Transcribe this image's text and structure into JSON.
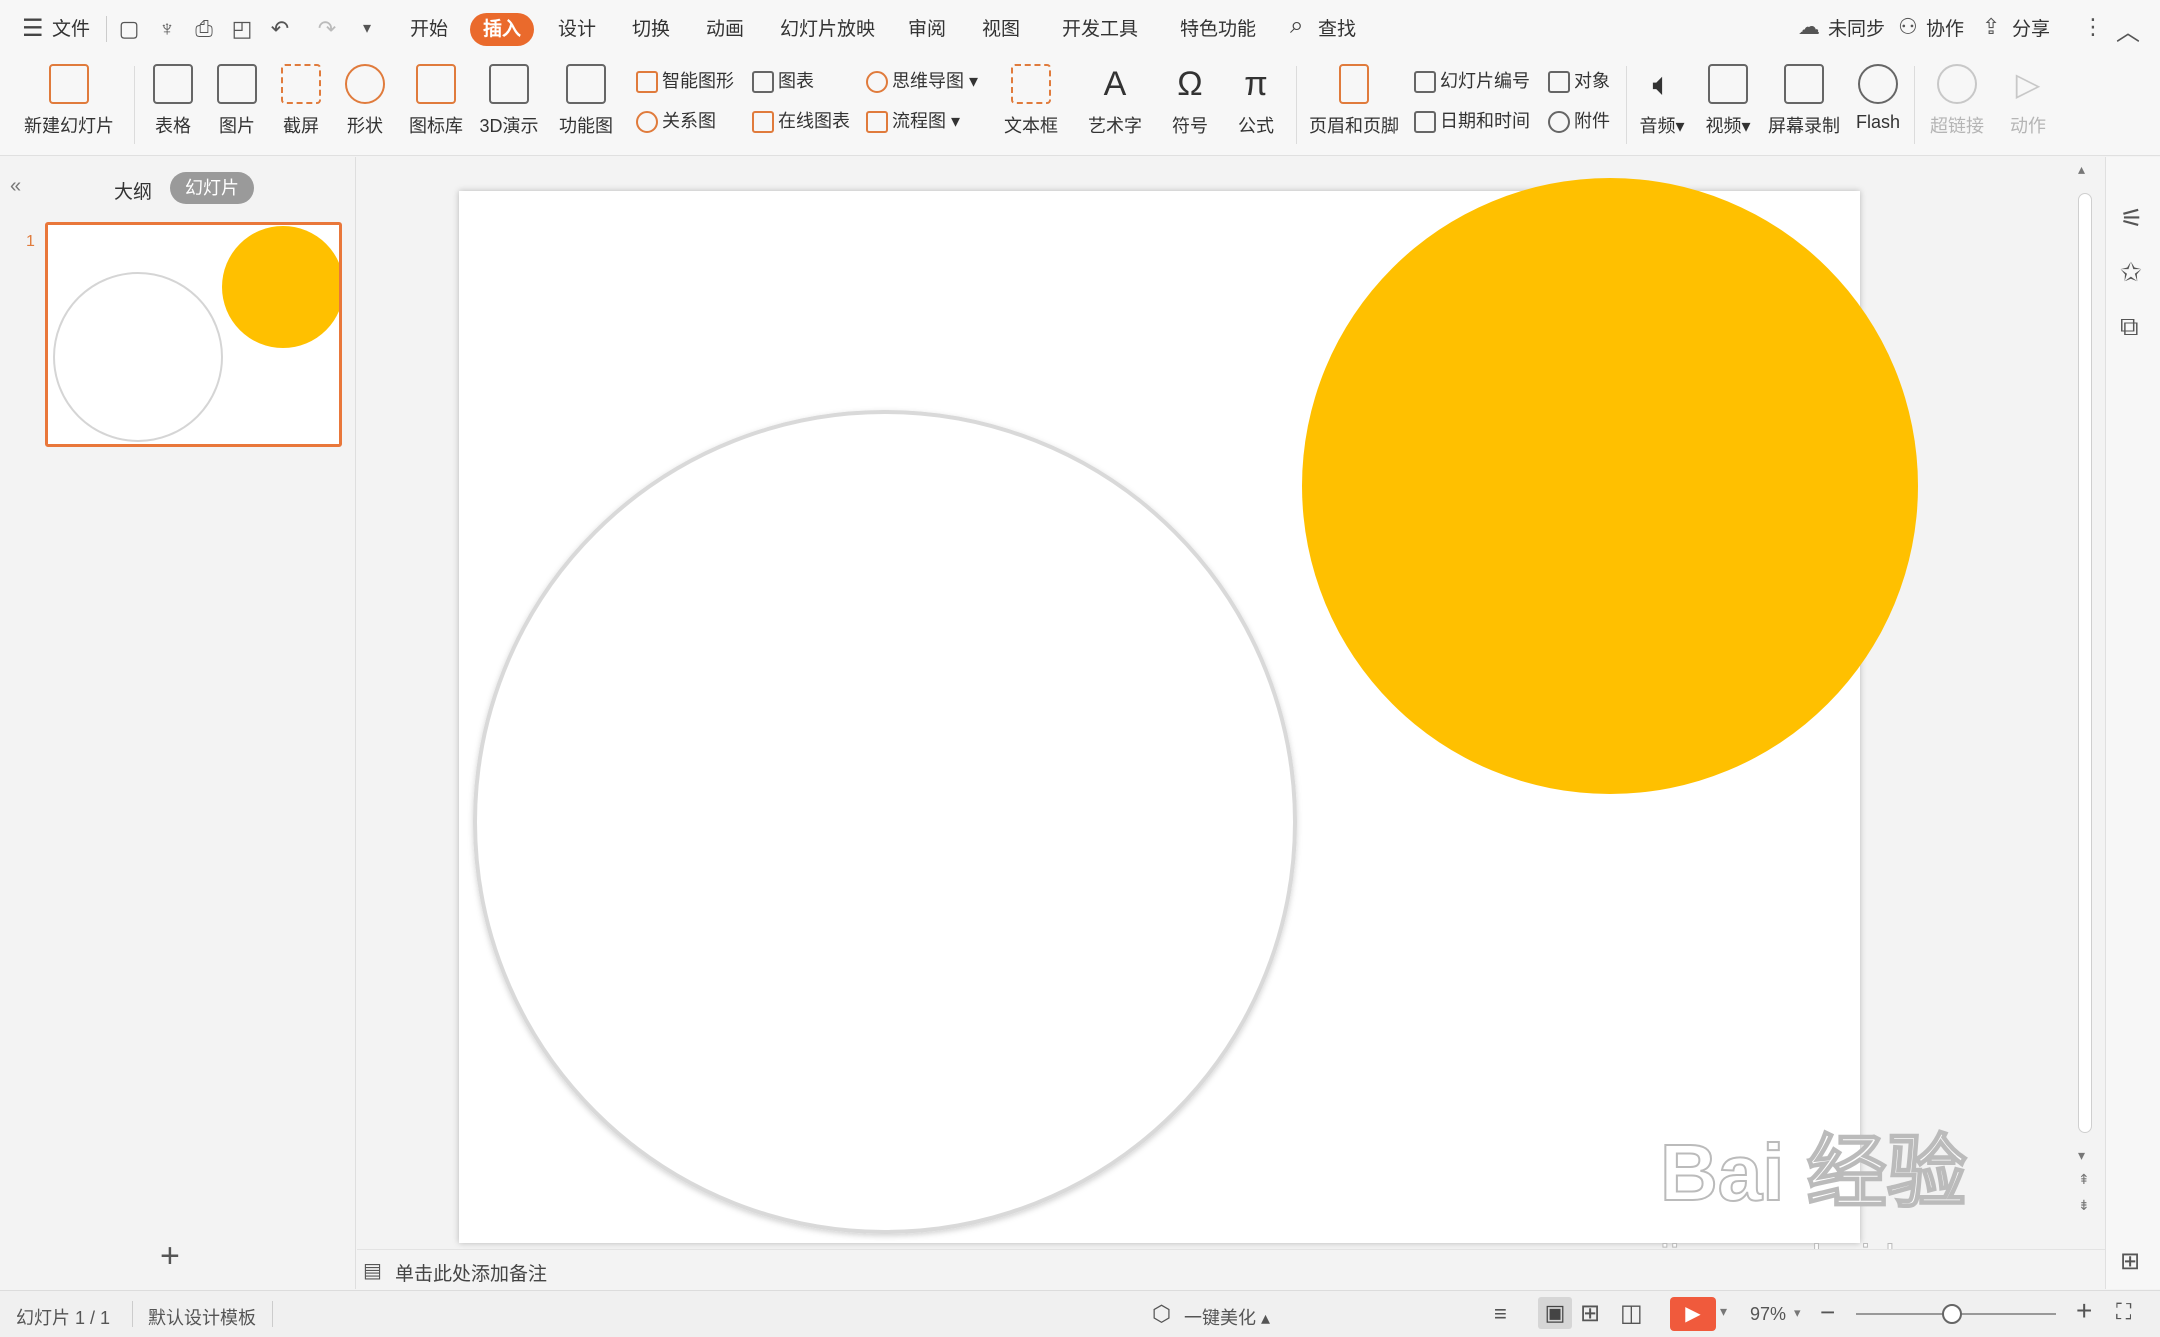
{
  "menubar": {
    "file": "文件",
    "tabs": [
      "开始",
      "插入",
      "设计",
      "切换",
      "动画",
      "幻灯片放映",
      "审阅",
      "视图",
      "开发工具",
      "特色功能"
    ],
    "active_tab": "插入",
    "search": "查找",
    "sync": "未同步",
    "collab": "协作",
    "share": "分享"
  },
  "ribbon": {
    "new_slide": "新建幻灯片",
    "table": "表格",
    "image": "图片",
    "screenshot": "截屏",
    "shape": "形状",
    "icon_lib": "图标库",
    "demo3d": "3D演示",
    "func_chart": "功能图",
    "smart_shape": "智能图形",
    "chart": "图表",
    "relation": "关系图",
    "online_chart": "在线图表",
    "mindmap": "思维导图",
    "flowchart": "流程图",
    "textbox": "文本框",
    "wordart": "艺术字",
    "symbol": "符号",
    "formula": "公式",
    "header_footer": "页眉和页脚",
    "slide_number": "幻灯片编号",
    "object": "对象",
    "datetime": "日期和时间",
    "attachment": "附件",
    "audio": "音频",
    "video": "视频",
    "screen_record": "屏幕录制",
    "flash": "Flash",
    "hyperlink": "超链接",
    "action": "动作"
  },
  "leftpanel": {
    "outline_tab": "大纲",
    "slides_tab": "幻灯片",
    "slide_number": "1"
  },
  "slide": {
    "shapes": [
      {
        "name": "outline-circle",
        "fill": "#ffffff",
        "stroke": "#d9d9d9"
      },
      {
        "name": "yellow-circle",
        "fill": "#ffc000"
      }
    ]
  },
  "notes": {
    "placeholder": "单击此处添加备注"
  },
  "statusbar": {
    "slide_info": "幻灯片 1 / 1",
    "template": "默认设计模板",
    "beautify": "一键美化",
    "zoom": "97%"
  },
  "watermark": {
    "brand": "Bai 经验",
    "url": "jingyan.baidu.com"
  },
  "colors": {
    "accent": "#ea6a2c",
    "yellow": "#ffc000"
  }
}
